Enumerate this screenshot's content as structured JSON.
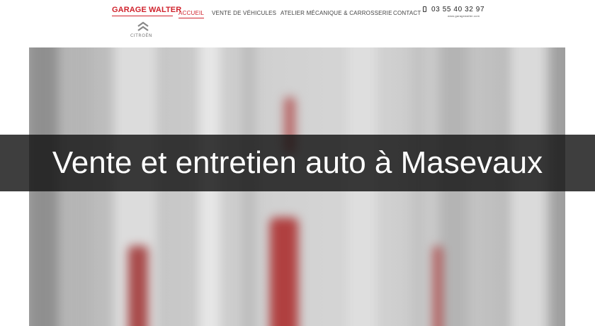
{
  "header": {
    "brand": "GARAGE WALTER",
    "partner_logo_text": "CITROËN",
    "nav": [
      {
        "label": "ACCUEIL",
        "active": true
      },
      {
        "label": "VENTE DE VÉHICULES",
        "active": false
      },
      {
        "label": "ATELIER MÉCANIQUE & CARROSSERIE",
        "active": false
      },
      {
        "label": "CONTACT",
        "active": false
      }
    ],
    "phone": "03 55 40 32 97",
    "website": "www.garagewalter.com"
  },
  "hero": {
    "title": "Vente et entretien auto à Masevaux"
  },
  "colors": {
    "accent": "#d0232d",
    "banner": "#141414",
    "background": "#ffffff"
  },
  "icons": {
    "phone": "phone-icon",
    "partner": "citroen-chevrons-icon"
  }
}
